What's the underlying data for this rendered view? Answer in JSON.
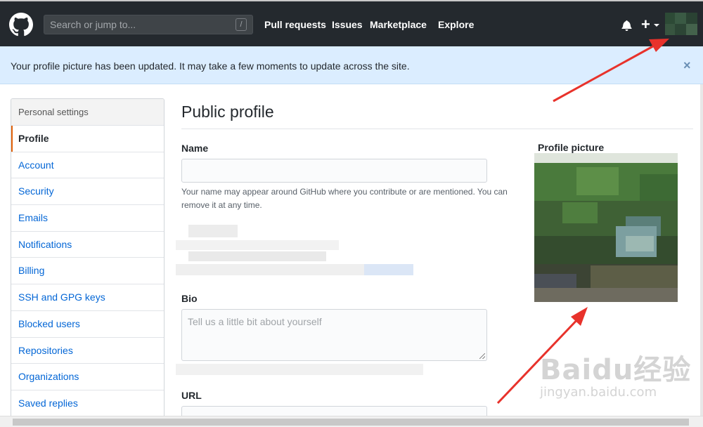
{
  "header": {
    "search_placeholder": "Search or jump to...",
    "search_shortcut": "/",
    "nav": [
      "Pull requests",
      "Issues",
      "Marketplace",
      "Explore"
    ],
    "plus_label": "+"
  },
  "flash": {
    "message": "Your profile picture has been updated. It may take a few moments to update across the site.",
    "close": "×"
  },
  "sidebar": {
    "heading": "Personal settings",
    "items": [
      {
        "label": "Profile",
        "selected": true
      },
      {
        "label": "Account"
      },
      {
        "label": "Security"
      },
      {
        "label": "Emails"
      },
      {
        "label": "Notifications"
      },
      {
        "label": "Billing"
      },
      {
        "label": "SSH and GPG keys"
      },
      {
        "label": "Blocked users"
      },
      {
        "label": "Repositories"
      },
      {
        "label": "Organizations"
      },
      {
        "label": "Saved replies"
      }
    ]
  },
  "main": {
    "title": "Public profile",
    "name_label": "Name",
    "name_value": "",
    "name_hint": "Your name may appear around GitHub where you contribute or are mentioned. You can remove it at any time.",
    "bio_label": "Bio",
    "bio_placeholder": "Tell us a little bit about yourself",
    "url_label": "URL",
    "picture_label": "Profile picture"
  },
  "watermark": {
    "main": "Baidu经验",
    "sub": "jingyan.baidu.com"
  },
  "colors": {
    "header_bg": "#24292e",
    "flash_bg": "#dbedff",
    "link": "#0366d6",
    "selected_accent": "#e36209",
    "arrow": "#e8322b"
  }
}
